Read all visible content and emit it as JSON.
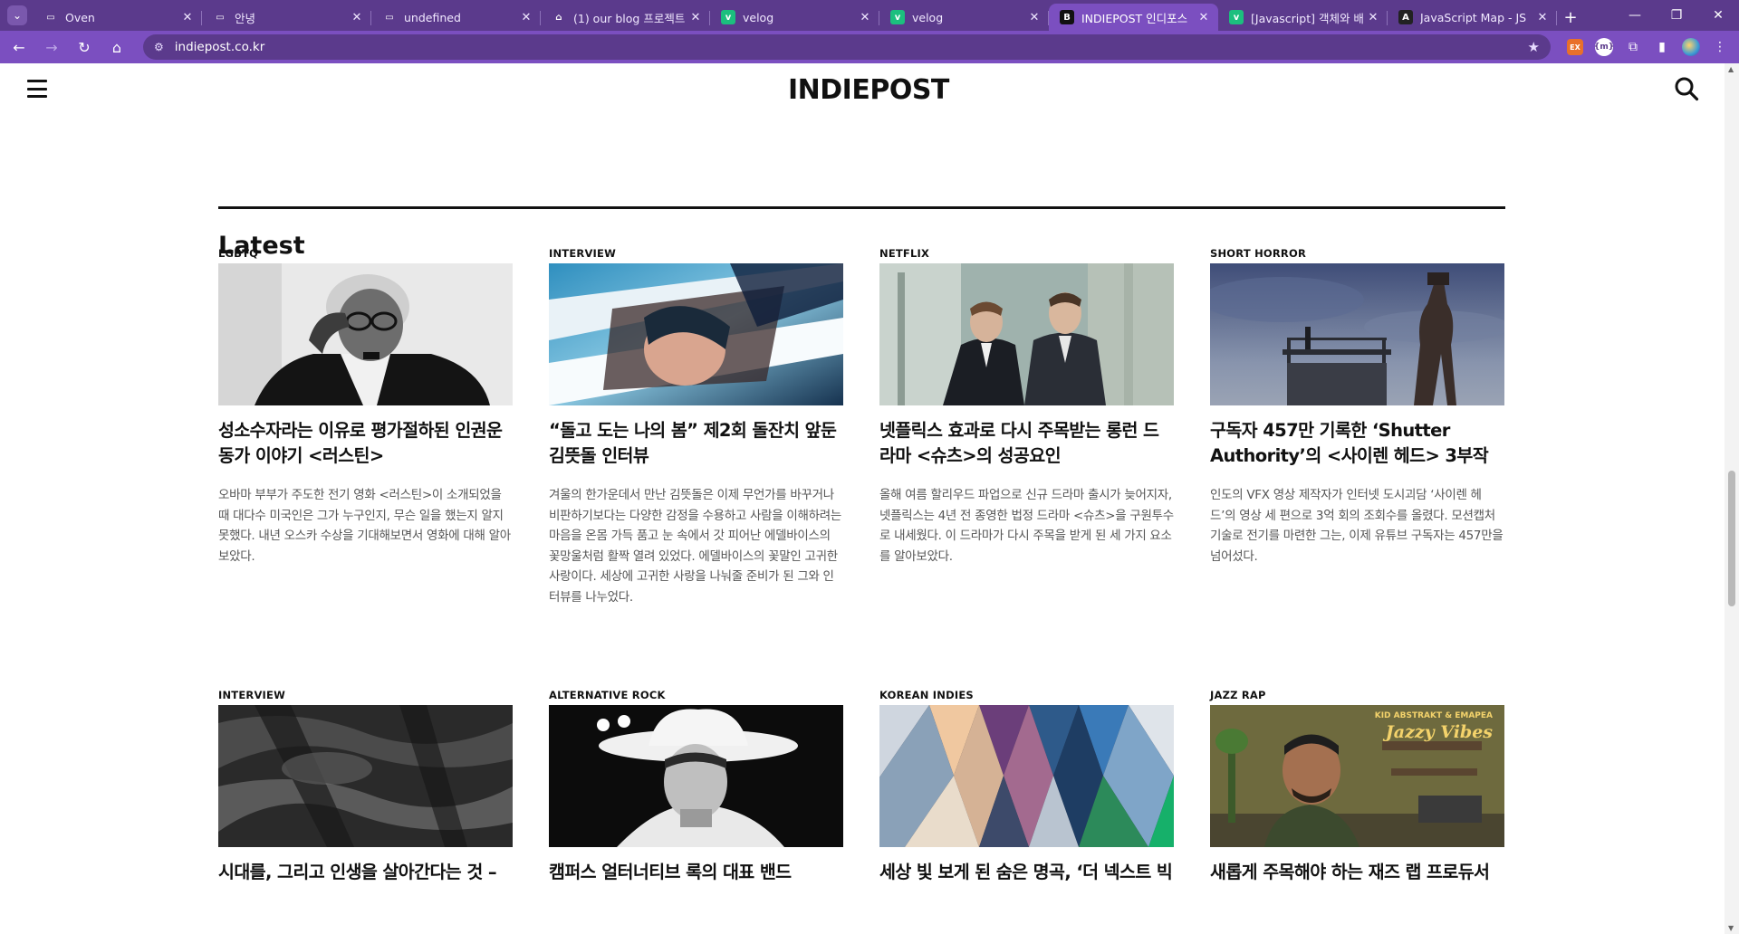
{
  "browser": {
    "tabs": [
      {
        "title": "Oven",
        "favicon": "monitor-icon",
        "color": "#5b3a8c"
      },
      {
        "title": "안녕",
        "favicon": "monitor-icon",
        "color": "#5b3a8c"
      },
      {
        "title": "undefined",
        "favicon": "monitor-icon",
        "color": "#5b3a8c"
      },
      {
        "title": "(1) our blog 프로젝트",
        "favicon": "house-icon",
        "color": "#5b3a8c"
      },
      {
        "title": "velog",
        "favicon": "velog-icon",
        "color": "#1cbf7e"
      },
      {
        "title": "velog",
        "favicon": "velog-icon",
        "color": "#1cbf7e"
      },
      {
        "title": "INDIEPOST 인디포스",
        "favicon": "indiepost-icon",
        "color": "#111111",
        "active": true
      },
      {
        "title": "[Javascript] 객체와 배",
        "favicon": "velog-icon",
        "color": "#1cbf7e"
      },
      {
        "title": "JavaScript Map - JS",
        "favicon": "js-icon",
        "color": "#222222"
      }
    ],
    "url": "indiepost.co.kr"
  },
  "site": {
    "logo": "INDIEPOST",
    "section_title": "Latest"
  },
  "articles": [
    {
      "category": "LGBTQ",
      "title": "성소수자라는 이유로 평가절하된 인권운동가 이야기 <러스틴>",
      "desc": "오바마 부부가 주도한 전기 영화 <러스틴>이 소개되었을 때 대다수 미국인은 그가 누구인지, 무슨 일을 했는지 알지 못했다. 내년 오스카 수상을 기대해보면서 영화에 대해 알아보았다.",
      "image": "portrait-bw"
    },
    {
      "category": "INTERVIEW",
      "title": "“돌고 도는 나의 봄” 제2회 돌잔치 앞둔 김뜻돌 인터뷰",
      "desc": "겨울의 한가운데서 만난 김뜻돌은 이제 무언가를 바꾸거나 비판하기보다는 다양한 감정을 수용하고 사람을 이해하려는 마음을 온몸 가득 품고 눈 속에서 갓 피어난 에델바이스의 꽃망울처럼 활짝 열려 있었다. 에델바이스의 꽃말인 고귀한 사랑이다. 세상에 고귀한 사랑을 나눠줄 준비가 된 그와 인터뷰를 나누었다.",
      "image": "blue-collage"
    },
    {
      "category": "NETFLIX",
      "title": "넷플릭스 효과로 다시 주목받는 롱런 드라마 <슈츠>의 성공요인",
      "desc": "올해 여름 할리우드 파업으로 신규 드라마 출시가 늦어지자, 넷플릭스는 4년 전 종영한 법정 드라마 <슈츠>을 구원투수로 내세웠다. 이 드라마가 다시 주목을 받게 된 세 가지 요소를 알아보았다.",
      "image": "suits"
    },
    {
      "category": "SHORT HORROR",
      "title": "구독자 457만 기록한 ‘Shutter Authority’의 <사이렌 헤드> 3부작",
      "desc": "인도의 VFX 영상 제작자가 인터넷 도시괴담 ‘사이렌 헤드’의 영상 세 편으로 3억 회의 조회수를 올렸다. 모션캡처 기술로 전기를 마련한 그는, 이제 유튜브 구독자는 457만을 넘어섰다.",
      "image": "siren-head"
    },
    {
      "category": "INTERVIEW",
      "title": "시대를, 그리고 인생을 살아간다는 것 –",
      "desc": "",
      "image": "dark-rock"
    },
    {
      "category": "ALTERNATIVE ROCK",
      "title": "캠퍼스 얼터너티브 록의 대표 밴드",
      "desc": "",
      "image": "cowboy-bw"
    },
    {
      "category": "KOREAN INDIES",
      "title": "세상 빛 보게 된 숨은 명곡, ‘더 넥스트 빅",
      "desc": "",
      "image": "triangles-collage"
    },
    {
      "category": "JAZZ RAP",
      "title": "새롭게 주목해야 하는 재즈 랩 프로듀서",
      "desc": "",
      "image": "jazzy-vibes"
    }
  ],
  "jazzy_image_text": {
    "line1": "KID ABSTRAKT & EMAPEA",
    "line2": "Jazzy Vibes"
  },
  "colors": {
    "chrome_dark": "#5b3a8c",
    "chrome": "#7b4fc0",
    "text": "#111111",
    "muted": "#555555"
  }
}
